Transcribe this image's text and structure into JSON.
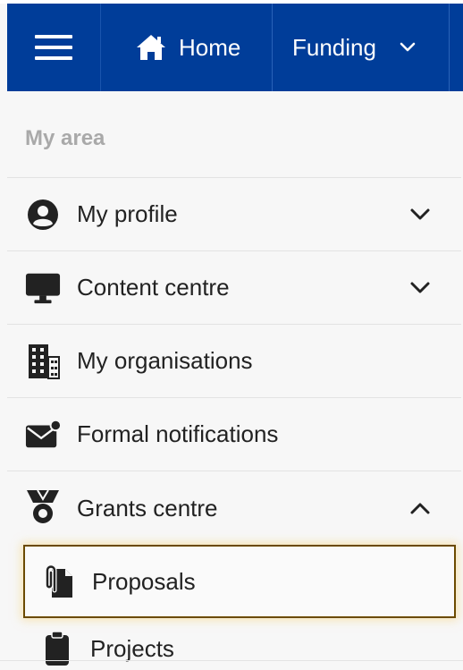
{
  "header": {
    "home_label": "Home",
    "funding_label": "Funding",
    "colors": {
      "bar": "#003d99",
      "text": "#ffffff"
    }
  },
  "menu": {
    "section_title": "My area",
    "items": [
      {
        "label": "My profile",
        "icon": "user-circle-icon",
        "chevron": "down"
      },
      {
        "label": "Content centre",
        "icon": "monitor-icon",
        "chevron": "down"
      },
      {
        "label": "My organisations",
        "icon": "building-icon"
      },
      {
        "label": "Formal notifications",
        "icon": "envelope-notification-icon"
      },
      {
        "label": "Grants centre",
        "icon": "medal-icon",
        "chevron": "up",
        "children": [
          {
            "label": "Proposals",
            "icon": "paperclip-document-icon",
            "highlighted": true
          },
          {
            "label": "Projects",
            "icon": "clipboard-icon"
          }
        ]
      }
    ]
  },
  "highlight_color": "#6b4a00"
}
